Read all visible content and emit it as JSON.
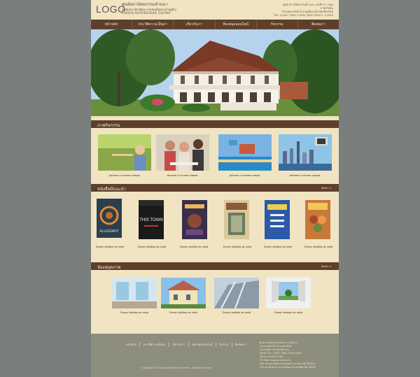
{
  "header": {
    "logo": "LOGO",
    "site_name_th": "ศูนย์สถาปัตยกรรมล้านนา",
    "site_sub_th": "(เฉลิมพระเกียรติพระบาทสมเด็จพระเจ้าอยู่หัว)",
    "site_name_en": "Lanna Architecture Center",
    "contact_lines": [
      "ศูนย์ สถาปัตยกรรมล้านนา เลขที่ 117 ถนนราชดำเนิน",
      "ตำบลพระสิงห์ อำเภอเมือง จังหวัดเชียงใหม่",
      "โทร. 0 5327 7855, 0 5344 2553 โทรสาร. 0 5322"
    ]
  },
  "nav": {
    "items": [
      "หน้าหลัก",
      "ประวัติความเป็นมา",
      "เกี่ยวกับเรา",
      "ห้องสมุดออนไลน์",
      "กิจกรรม",
      "ติดต่อเรา"
    ]
  },
  "activities": {
    "title": "ภาพกิจกรรม",
    "items": [
      {
        "caption": "Aenean ut ornare massa."
      },
      {
        "caption": "Aenean ut ornare massa."
      },
      {
        "caption": "Aenean ut ornare massa."
      },
      {
        "caption": "Aenean ut ornare massa."
      }
    ]
  },
  "books": {
    "title": "หนังสือมีแนะนำ",
    "more": "More >>",
    "items": [
      {
        "caption": "Donec facilisis ac nulla",
        "cover_title": "ALLEGIANT"
      },
      {
        "caption": "Donec facilisis ac nulla",
        "cover_title": "THIS TOWN"
      },
      {
        "caption": "Donec facilisis ac nulla",
        "cover_title": ""
      },
      {
        "caption": "Donec facilisis ac nulla",
        "cover_title": ""
      },
      {
        "caption": "Donec facilisis ac nulla",
        "cover_title": ""
      },
      {
        "caption": "Donec facilisis ac nulla",
        "cover_title": ""
      }
    ]
  },
  "library": {
    "title": "ห้องสมุดภาพ",
    "more": "More >>",
    "items": [
      {
        "caption": "Donec facilisis ac nulla"
      },
      {
        "caption": "Donec facilisis ac nulla"
      },
      {
        "caption": "Donec facilisis ac nulla"
      },
      {
        "caption": "Donec facilisis ac nulla"
      }
    ]
  },
  "footer": {
    "links": [
      "หน้าหลัก",
      "ประวัติความเป็นมา",
      "เกี่ยวกับเรา",
      "ห้องสมุดออนไลน์",
      "กิจกรรม",
      "ติดต่อเรา"
    ],
    "address_lines": [
      "ศูนย์ สถาปัตยกรรมล้านนา เลขที่ 117",
      "ถนนราชดำเนิน ตำบลพระสิงห์",
      "อำเภอเมือง จังหวัดเชียงใหม่",
      "50000 โทร. 0 5327 7855, 0 5344 2553",
      "โทรสาร 0 5322 1446",
      "เว็บ http://www.lac.cmu.ac.th",
      "หรือ คณะสถาปัตยกรรมศาสตร์ มหาวิทยาลัยเชียงใหม่",
      "239 ถนนห้วยแก้ว อำเภอเมือง จังหวัดเชียงใหม่ 50200"
    ],
    "copyright": "Copyright © 2013 Lanna Architecture Center . All rights reserved."
  },
  "colors": {
    "background": "#7a7f7e",
    "page": "#f1e4c3",
    "bar": "#5e3f2c",
    "footer": "#8d8e7b"
  }
}
